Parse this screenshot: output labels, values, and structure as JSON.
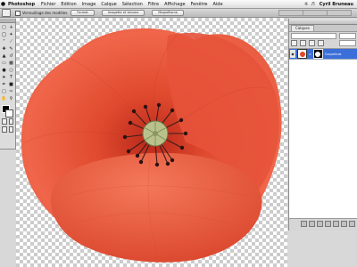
{
  "menubar": {
    "apple": "",
    "app_name": "Photoshop",
    "items": [
      "Fichier",
      "Edition",
      "Image",
      "Calque",
      "Sélection",
      "Filtre",
      "Affichage",
      "Fenêtre",
      "Aide"
    ],
    "user": "Cyril Bruneau"
  },
  "optbar": {
    "checkbox_label": "Verrouillage des modèles",
    "buttons": [
      "Format",
      "Imagette et Volume",
      "Magnétisme"
    ]
  },
  "panel": {
    "tabs": [
      "Calques"
    ],
    "layer_name": "Coquelicot"
  },
  "colors": {
    "petal": "#e8553b",
    "petal_dark": "#c03a22",
    "center": "#b8c28a",
    "stamen": "#3d1d1a",
    "layer_selected": "#3a6ed8"
  }
}
